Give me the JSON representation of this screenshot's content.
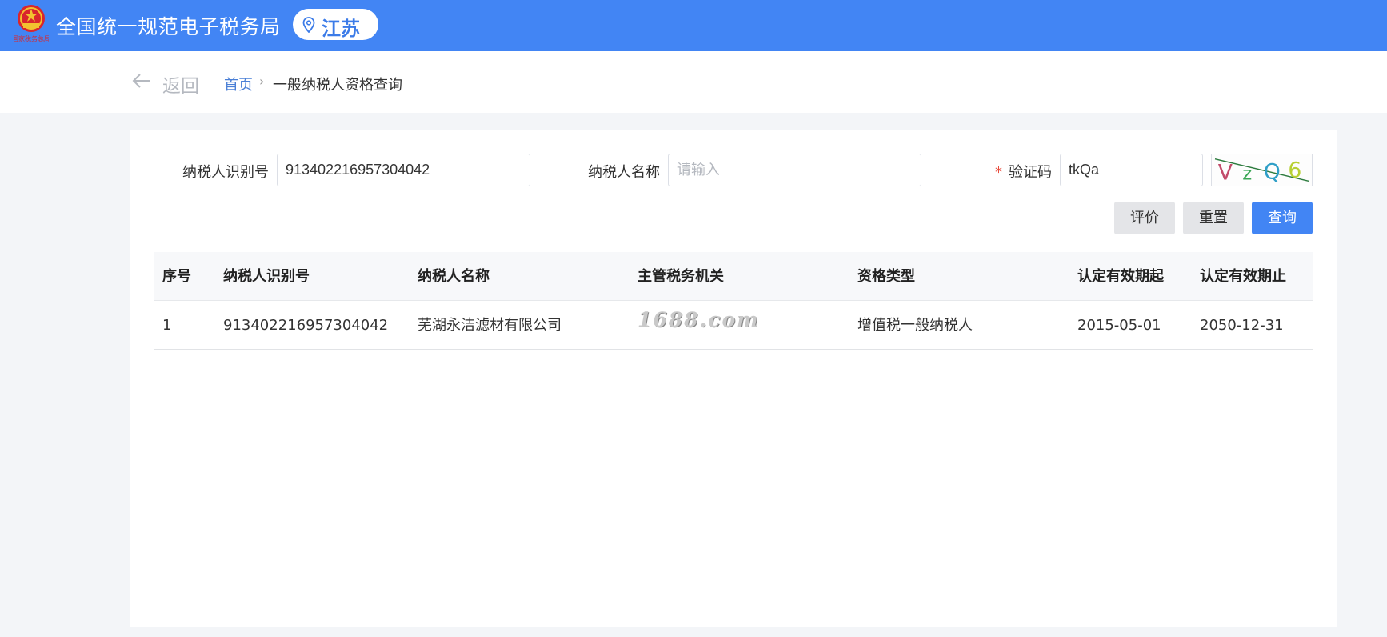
{
  "header": {
    "site_title": "全国统一规范电子税务局",
    "region": "江苏",
    "emblem_text": "国家税务总局",
    "colors": {
      "bar": "#4285f4",
      "region_text": "#3b7be8"
    }
  },
  "subnav": {
    "back_label": "返回",
    "breadcrumb": {
      "home": "首页",
      "separator": "›",
      "current": "一般纳税人资格查询"
    }
  },
  "form": {
    "taxpayer_id": {
      "label": "纳税人识别号",
      "value": "913402216957304042"
    },
    "taxpayer_name": {
      "label": "纳税人名称",
      "value": "",
      "placeholder": "请输入"
    },
    "captcha": {
      "required_mark": "*",
      "label": "验证码",
      "value": "tkQa",
      "image_text": "VZQ6"
    },
    "buttons": {
      "evaluate": "评价",
      "reset": "重置",
      "query": "查询"
    }
  },
  "table": {
    "headers": [
      "序号",
      "纳税人识别号",
      "纳税人名称",
      "主管税务机关",
      "资格类型",
      "认定有效期起",
      "认定有效期止"
    ],
    "rows": [
      [
        "1",
        "913402216957304042",
        "芜湖永洁滤材有限公司",
        "",
        "增值税一般纳税人",
        "2015-05-01",
        "2050-12-31"
      ]
    ]
  },
  "watermark": "1688.com"
}
